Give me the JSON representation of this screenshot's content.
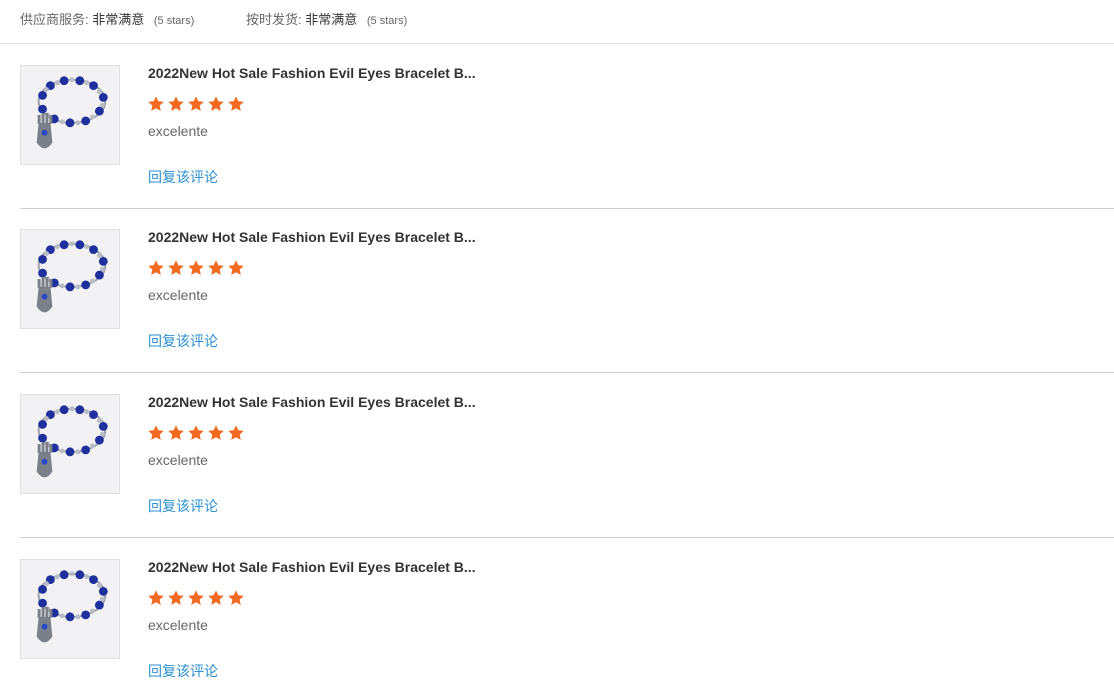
{
  "summary": {
    "supplier_service": {
      "label": "供应商服务:",
      "value": "非常满意",
      "note": "(5 stars)"
    },
    "on_time_shipping": {
      "label": "按时发货:",
      "value": "非常满意",
      "note": "(5 stars)"
    }
  },
  "reviews": [
    {
      "title": "2022New Hot Sale Fashion Evil Eyes Bracelet B...",
      "rating": 5,
      "text": "excelente",
      "reply_label": "回复该评论",
      "thumb_icon": "bracelet-image"
    },
    {
      "title": "2022New Hot Sale Fashion Evil Eyes Bracelet B...",
      "rating": 5,
      "text": "excelente",
      "reply_label": "回复该评论",
      "thumb_icon": "bracelet-image"
    },
    {
      "title": "2022New Hot Sale Fashion Evil Eyes Bracelet B...",
      "rating": 5,
      "text": "excelente",
      "reply_label": "回复该评论",
      "thumb_icon": "bracelet-image"
    },
    {
      "title": "2022New Hot Sale Fashion Evil Eyes Bracelet B...",
      "rating": 5,
      "text": "excelente",
      "reply_label": "回复该评论",
      "thumb_icon": "bracelet-image"
    }
  ],
  "colors": {
    "star": "#f26a21",
    "link": "#2a8fd0",
    "divider": "#cfcfcf"
  }
}
